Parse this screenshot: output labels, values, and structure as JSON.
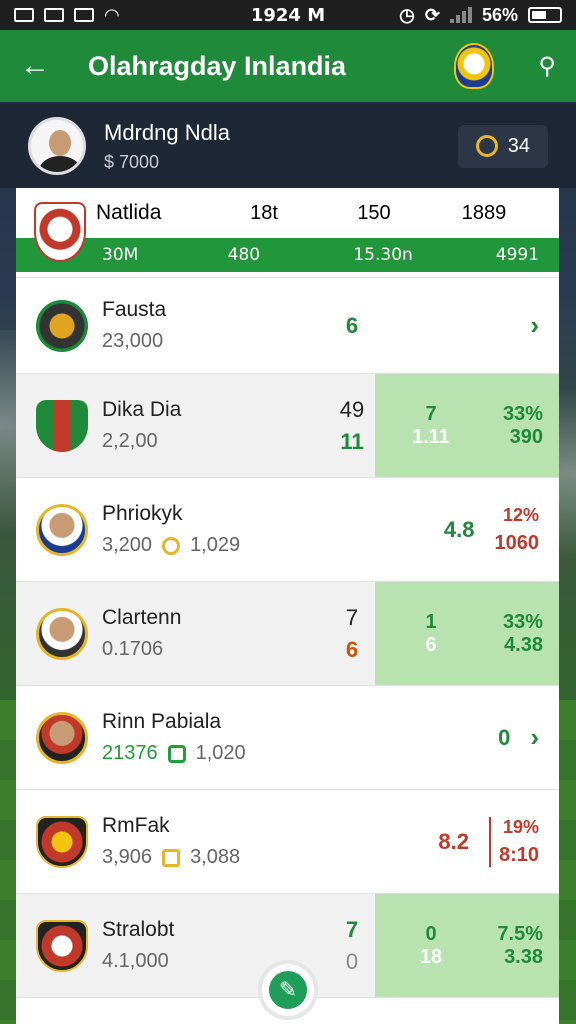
{
  "status": {
    "time": "1924 M",
    "battery": "56%"
  },
  "appbar": {
    "title": "Olahragday Inlandia",
    "back_icon": "arrow-left-icon",
    "share_icon": "share-icon"
  },
  "user": {
    "name": "Mdrdng Ndla",
    "balance": "$ 7000",
    "coins": "34"
  },
  "header": {
    "name": "Natlida",
    "v1": "18t",
    "v2": "150",
    "v3": "1889",
    "b1": "30M",
    "b2": "480",
    "b3": "15.30n",
    "b4": "4991"
  },
  "rows": [
    {
      "name": "Fausta",
      "sub": "23,000",
      "a": "6"
    },
    {
      "name": "Dika Dia",
      "sub": "2,2,00",
      "a1": "49",
      "a2": "11",
      "h1": "7",
      "h2": "1.11",
      "p1": "33%",
      "p2": "390"
    },
    {
      "name": "Phriokyk",
      "sub1": "3,200",
      "sub2": "1,029",
      "a": "4.8",
      "p1": "12%",
      "p2": "1060"
    },
    {
      "name": "Clartenn",
      "sub": "0.1706",
      "a1": "7",
      "a2": "6",
      "h1": "1",
      "h2": "6",
      "p1": "33%",
      "p2": "4.38"
    },
    {
      "name": "Rinn Pabiala",
      "sub1": "21376",
      "sub2": "1,020",
      "a": "0"
    },
    {
      "name": "RmFak",
      "sub1": "3,906",
      "sub2": "3,088",
      "a": "8.2",
      "p1": "19%",
      "p2": "8:10"
    },
    {
      "name": "Stralobt",
      "sub": "4.1,000",
      "a1": "7",
      "a2": "0",
      "h1": "0",
      "h2": "18",
      "p1": "7.5%",
      "p2": "3.38"
    }
  ]
}
